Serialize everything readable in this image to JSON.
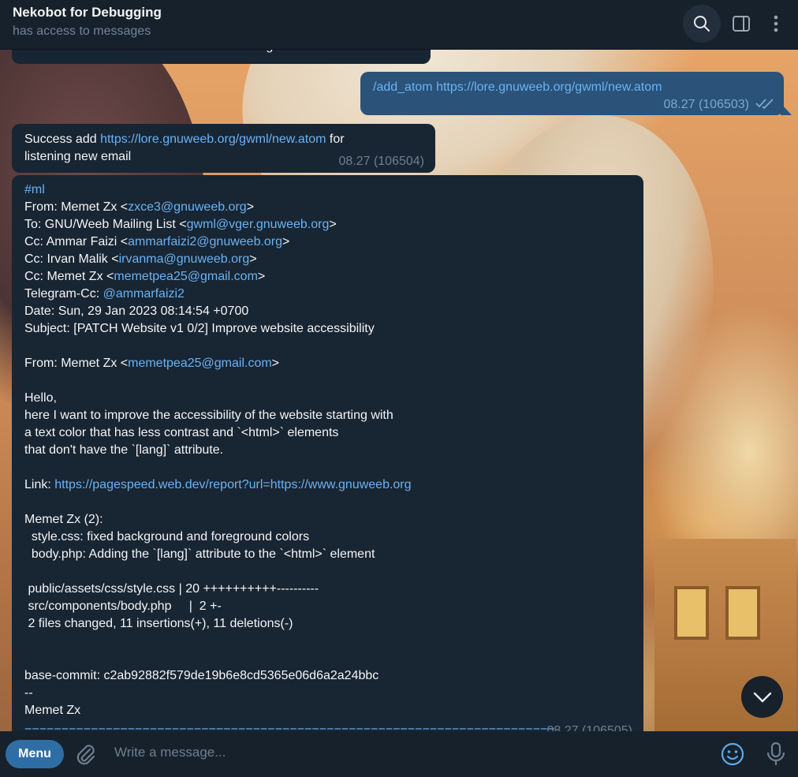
{
  "header": {
    "title": "Nekobot for Debugging",
    "subtitle": "has access to messages"
  },
  "messages": {
    "top_partial": {
      "text": "See the full message"
    },
    "outgoing": {
      "command": "/add_atom",
      "link": "https://lore.gnuweeb.org/gwml/new.atom",
      "meta": "08.27 (106503)"
    },
    "incoming_1": {
      "prefix": "Success add ",
      "link": "https://lore.gnuweeb.org/gwml/new.atom",
      "suffix": " for listening new email",
      "meta": "08.27 (106504)"
    },
    "incoming_2": {
      "hashtag": "#ml",
      "from_label": "From: Memet Zx <",
      "from_email": "zxce3@gnuweeb.org",
      "to_label": "To: GNU/Weeb Mailing List <",
      "to_email": "gwml@vger.gnuweeb.org",
      "cc1_label": "Cc: Ammar Faizi <",
      "cc1_email": "ammarfaizi2@gnuweeb.org",
      "cc2_label": "Cc: Irvan Malik <",
      "cc2_email": "irvanma@gnuweeb.org",
      "cc3_label": "Cc: Memet Zx <",
      "cc3_email": "memetpea25@gmail.com",
      "tgcc_label": "Telegram-Cc: ",
      "tgcc_handle": "@ammarfaizi2",
      "date": "Date: Sun, 29 Jan 2023 08:14:54 +0700",
      "subject": "Subject: [PATCH Website v1 0/2] Improve website accessibility",
      "from2_label": "From: Memet Zx <",
      "from2_email": "memetpea25@gmail.com",
      "body1": "Hello,\nhere I want to improve the accessibility of the website starting with\na text color that has less contrast and `<html>` elements\nthat don't have the `[lang]` attribute.",
      "link_label": "Link: ",
      "link_url": "https://pagespeed.web.dev/report?url=https://www.gnuweeb.org",
      "body2": "Memet Zx (2):\n  style.css: fixed background and foreground colors\n  body.php: Adding the `[lang]` attribute to the `<html>` element\n\n public/assets/css/style.css | 20 ++++++++++----------\n src/components/body.php     |  2 +-\n 2 files changed, 11 insertions(+), 11 deletions(-)\n\n\nbase-commit: c2ab92882f579de19b6e8cd5365e06d6a2a24bbc\n--\nMemet Zx",
      "rule": "========================================================================",
      "meta": "08.27 (106505)"
    }
  },
  "composer": {
    "menu_label": "Menu",
    "placeholder": "Write a message..."
  },
  "icons": {
    "search": "search-icon",
    "sidebar": "sidebar-toggle-icon",
    "more": "more-vertical-icon",
    "attach": "paperclip-icon",
    "emoji": "emoji-icon",
    "mic": "microphone-icon",
    "scroll": "chevron-down-icon",
    "read": "double-check-icon"
  },
  "colors": {
    "accent": "#6ab3f3",
    "outgoing_bubble": "#2b5278",
    "incoming_bubble": "#182533",
    "header_bg": "#17212b"
  }
}
